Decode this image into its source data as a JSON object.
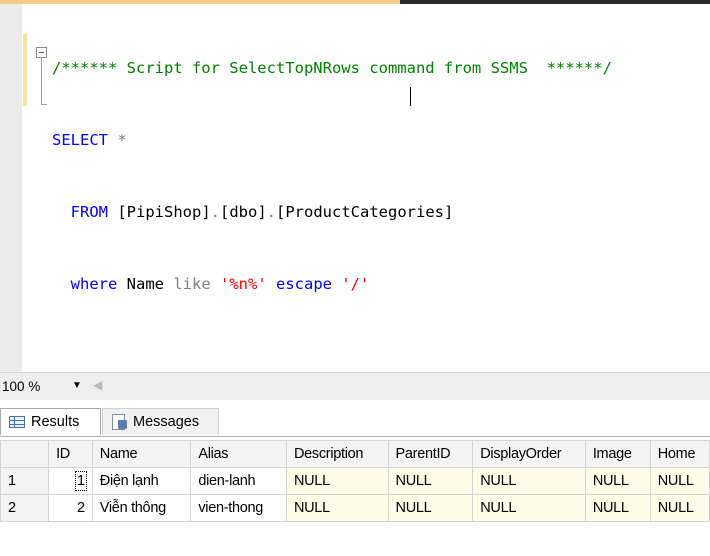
{
  "editor": {
    "lines": [
      [
        {
          "t": "/****** Script for SelectTopNRows command from SSMS  ******/",
          "c": "cm"
        }
      ],
      [
        {
          "t": "SELECT ",
          "c": "kw"
        },
        {
          "t": "*",
          "c": "gr"
        }
      ],
      [
        {
          "t": "  FROM ",
          "c": "kw"
        },
        {
          "t": "[PipiShop]",
          "c": "id"
        },
        {
          "t": ".",
          "c": "gr"
        },
        {
          "t": "[dbo]",
          "c": "id"
        },
        {
          "t": ".",
          "c": "gr"
        },
        {
          "t": "[ProductCategories]",
          "c": "id"
        }
      ],
      [
        {
          "t": "  where ",
          "c": "kw"
        },
        {
          "t": "Name ",
          "c": "id"
        },
        {
          "t": "like ",
          "c": "gr"
        },
        {
          "t": "'%n%' ",
          "c": "st"
        },
        {
          "t": "escape ",
          "c": "kw"
        },
        {
          "t": "'/'",
          "c": "st"
        }
      ]
    ]
  },
  "zoom": {
    "value": "100 %"
  },
  "results_tabs": {
    "results": "Results",
    "messages": "Messages"
  },
  "grid": {
    "columns": [
      "",
      "ID",
      "Name",
      "Alias",
      "Description",
      "ParentID",
      "DisplayOrder",
      "Image",
      "Home"
    ],
    "rows": [
      [
        "1",
        "1",
        "Điện lạnh",
        "dien-lanh",
        "NULL",
        "NULL",
        "NULL",
        "NULL",
        "NULL"
      ],
      [
        "2",
        "2",
        "Viễn thông",
        "vien-thong",
        "NULL",
        "NULL",
        "NULL",
        "NULL",
        "NULL"
      ]
    ]
  }
}
